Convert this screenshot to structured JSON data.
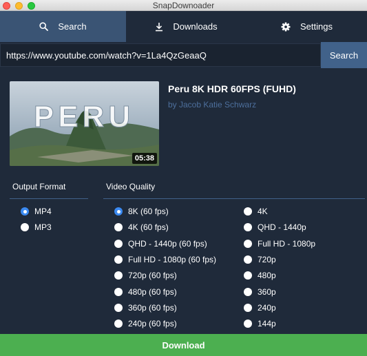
{
  "window": {
    "title": "SnapDownoader"
  },
  "tabs": {
    "search": {
      "label": "Search",
      "icon": "search-icon"
    },
    "downloads": {
      "label": "Downloads",
      "icon": "download-icon"
    },
    "settings": {
      "label": "Settings",
      "icon": "gear-icon"
    }
  },
  "url_bar": {
    "value": "https://www.youtube.com/watch?v=1La4QzGeaaQ",
    "button_label": "Search"
  },
  "video": {
    "thumbnail_text": "PERU",
    "duration": "05:38",
    "title": "Peru 8K HDR 60FPS (FUHD)",
    "author": "by Jacob Katie Schwarz"
  },
  "output_format": {
    "heading": "Output Format",
    "options": [
      {
        "label": "MP4",
        "selected": true
      },
      {
        "label": "MP3",
        "selected": false
      }
    ]
  },
  "video_quality": {
    "heading": "Video Quality",
    "column_1": [
      {
        "label": "8K (60 fps)",
        "selected": true
      },
      {
        "label": "4K (60 fps)",
        "selected": false
      },
      {
        "label": "QHD - 1440p (60 fps)",
        "selected": false
      },
      {
        "label": "Full HD - 1080p (60 fps)",
        "selected": false
      },
      {
        "label": "720p (60 fps)",
        "selected": false
      },
      {
        "label": "480p (60 fps)",
        "selected": false
      },
      {
        "label": "360p (60 fps)",
        "selected": false
      },
      {
        "label": "240p (60 fps)",
        "selected": false
      }
    ],
    "column_2": [
      {
        "label": "4K",
        "selected": false
      },
      {
        "label": "QHD - 1440p",
        "selected": false
      },
      {
        "label": "Full HD - 1080p",
        "selected": false
      },
      {
        "label": "720p",
        "selected": false
      },
      {
        "label": "480p",
        "selected": false
      },
      {
        "label": "360p",
        "selected": false
      },
      {
        "label": "240p",
        "selected": false
      },
      {
        "label": "144p",
        "selected": false
      }
    ]
  },
  "download_button": {
    "label": "Download"
  },
  "colors": {
    "background": "#1f2a3a",
    "active_tab": "#3a5474",
    "accent": "#41628a",
    "radio_selected": "#3b8af2",
    "author_link": "#4d6f9c",
    "download_green": "#4caf50"
  }
}
